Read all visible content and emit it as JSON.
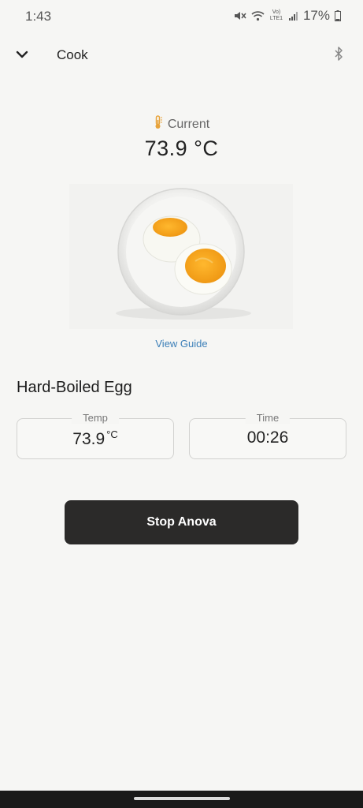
{
  "status_bar": {
    "time": "1:43",
    "network_label": "Vo) LTE1",
    "battery": "17%",
    "icons": [
      "mute-icon",
      "wifi-icon",
      "signal-icon",
      "battery-icon"
    ]
  },
  "header": {
    "title": "Cook",
    "left_icon": "chevron-down-icon",
    "right_icon": "bluetooth-icon"
  },
  "current": {
    "label": "Current",
    "value": "73.9 °C",
    "icon": "thermometer-icon",
    "icon_color": "#e8a33a"
  },
  "recipe": {
    "image_alt": "Hard-boiled eggs in a white bowl",
    "view_guide": "View Guide",
    "title": "Hard-Boiled Egg",
    "temp_label": "Temp",
    "temp_value": "73.9",
    "temp_unit": "°C",
    "time_label": "Time",
    "time_value": "00:26"
  },
  "actions": {
    "stop_label": "Stop Anova"
  },
  "colors": {
    "background": "#f6f6f4",
    "link": "#3c7fb8",
    "button_bg": "#2b2a29",
    "button_text": "#ffffff"
  }
}
